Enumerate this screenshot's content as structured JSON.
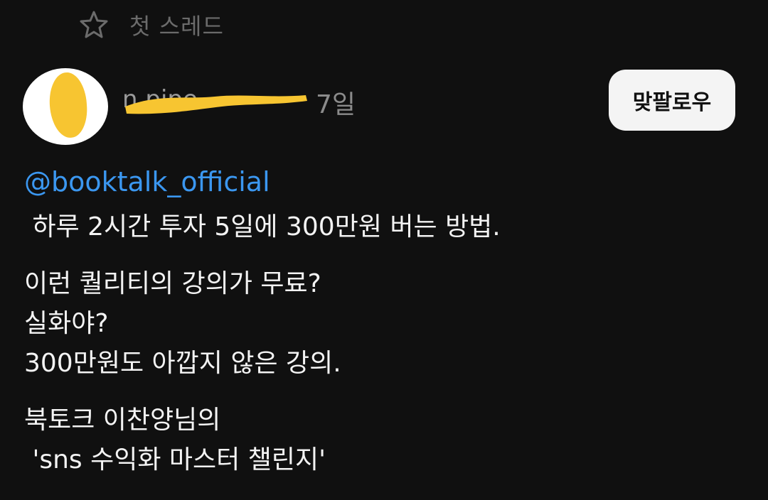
{
  "thread_header": {
    "label": "첫 스레드",
    "icon": "star-icon"
  },
  "author": {
    "avatar_icon": "avatar",
    "name_visible_fragment": "n                   pipe",
    "post_age": "7일"
  },
  "follow_button": {
    "label": "맞팔로우"
  },
  "post": {
    "mention": "@booktalk_official",
    "paragraphs": [
      [
        " 하루 2시간 투자 5일에 300만원 버는 방법."
      ],
      [
        "이런 퀄리티의 강의가 무료?",
        "실화야?",
        "300만원도 아깝지 않은 강의."
      ],
      [
        "북토크 이찬양님의",
        " 'sns 수익화 마스터 챌린지'"
      ]
    ]
  },
  "colors": {
    "background": "#101010",
    "mention": "#3b97f0",
    "redaction": "#f7c531"
  }
}
